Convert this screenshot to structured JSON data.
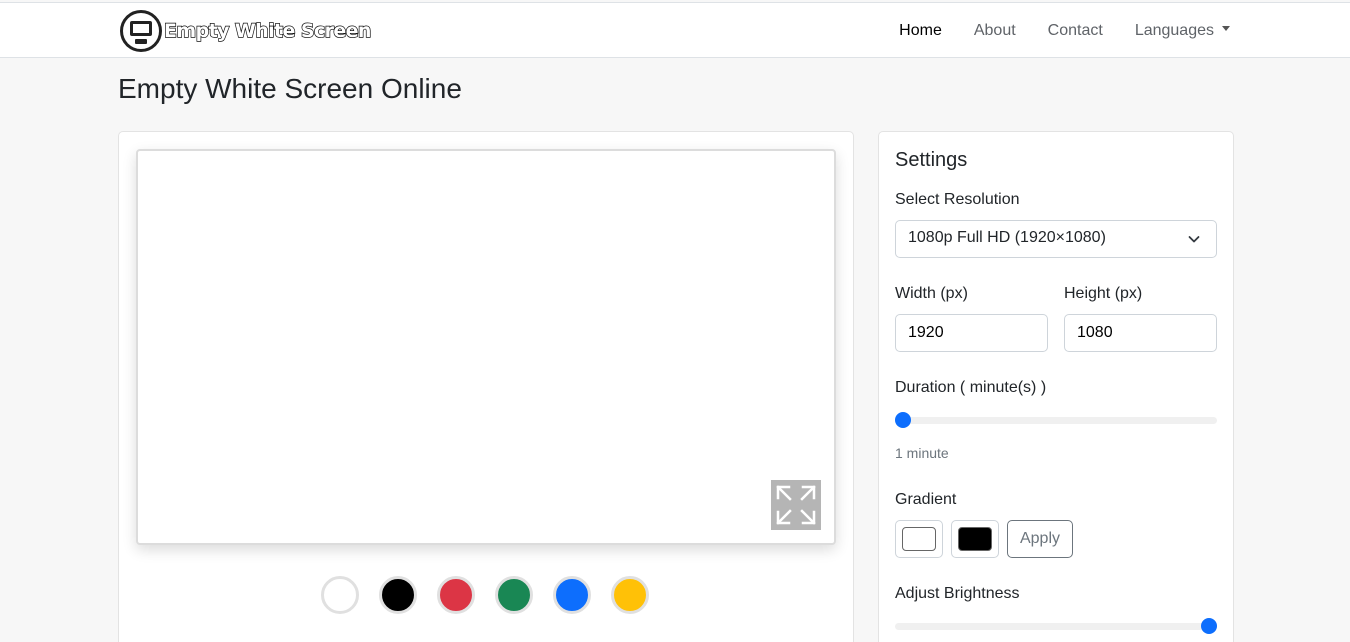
{
  "nav": {
    "brand": "Empty White Screen",
    "links": [
      "Home",
      "About",
      "Contact",
      "Languages"
    ]
  },
  "page_title": "Empty White Screen Online",
  "swatches": {
    "colors": [
      "#ffffff",
      "#000000",
      "#dc3545",
      "#198754",
      "#0d6efd",
      "#ffc107"
    ]
  },
  "settings": {
    "title": "Settings",
    "resolution_label": "Select Resolution",
    "resolution_value": "1080p Full HD (1920×1080)",
    "width_label": "Width (px)",
    "width_value": "1920",
    "height_label": "Height (px)",
    "height_value": "1080",
    "duration_label": "Duration ( minute(s) )",
    "duration_value_fraction": 0.0,
    "duration_text": "1 minute",
    "gradient_label": "Gradient",
    "gradient_start": "#ffffff",
    "gradient_end": "#000000",
    "apply_label": "Apply",
    "brightness_label": "Adjust Brightness",
    "brightness_value_fraction": 1.0
  },
  "colors": {
    "accent": "#0d6efd",
    "preview_bg": "#ffffff"
  }
}
